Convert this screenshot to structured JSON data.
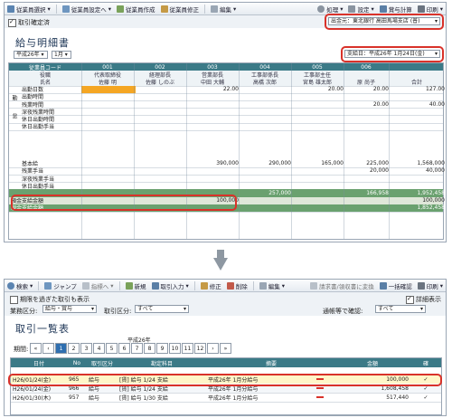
{
  "top": {
    "toolbar": {
      "select_label": "従業員選択",
      "settings_label": "従業員設定へ",
      "create_label": "従業員作成",
      "edit_label": "従業員修正",
      "edit_menu_label": "編集",
      "process_label": "処理",
      "config_label": "設定",
      "bonus_label": "賞与計算",
      "print_label": "印刷"
    },
    "confirmed_label": "取引確定済",
    "payer_label": "出金元：東北銀行 高田馬場支店 (普)",
    "title": "給与明細書",
    "year_select": "平成26年",
    "month_select": "1月",
    "payday_label": "支給日：平成26年 1月24日(金)",
    "grid": {
      "left_labels": [
        "従業員コード",
        "役職",
        "氏名"
      ],
      "codes": [
        "001",
        "002",
        "003",
        "004",
        "005",
        "006"
      ],
      "positions": [
        "代表取締役",
        "経理部長",
        "営業部長",
        "工事部係長",
        "工事部主任",
        ""
      ],
      "names": [
        "佐藤 明",
        "佐藤 しのぶ",
        "中田 大輔",
        "高橋 次郎",
        "宮島 雄太郎",
        "原 尚子"
      ],
      "total_header": "合計",
      "section_attendance": "勤怠",
      "attendance_rows": [
        {
          "label": "出勤日数",
          "values": [
            "",
            "",
            "22.00",
            "",
            "20.00",
            "20.00",
            "127.00"
          ]
        },
        {
          "label": "出勤時間",
          "values": [
            "",
            "",
            "",
            "",
            "",
            "",
            ""
          ]
        },
        {
          "label": "残業時間",
          "values": [
            "",
            "",
            "",
            "",
            "",
            "20.00",
            "40.00"
          ]
        },
        {
          "label": "深夜残業時間",
          "values": [
            "",
            "",
            "",
            "",
            "",
            "",
            ""
          ]
        },
        {
          "label": "休日出勤時間",
          "values": [
            "",
            "",
            "",
            "",
            "",
            "",
            ""
          ]
        },
        {
          "label": "休日出勤手当",
          "values": [
            "",
            "",
            "",
            "",
            "",
            "",
            ""
          ]
        }
      ],
      "pay_rows": [
        {
          "label": "基本給",
          "values": [
            "",
            "",
            "390,000",
            "290,000",
            "165,000",
            "225,000",
            "1,568,000"
          ]
        },
        {
          "label": "残業手当",
          "values": [
            "",
            "",
            "",
            "",
            "",
            "20,000",
            "40,000"
          ]
        },
        {
          "label": "深夜残業手当",
          "values": [
            "",
            "",
            "",
            "",
            "",
            "",
            ""
          ]
        },
        {
          "label": "休日出勤手当",
          "values": [
            "",
            "",
            "",
            "",
            "",
            "",
            ""
          ]
        }
      ],
      "green_row_values": [
        "",
        "",
        "",
        "257,000",
        "",
        "166,958",
        "1,952,458"
      ],
      "highlight_row": {
        "label": "預金支給金額",
        "values": [
          "",
          "",
          "100,000",
          "",
          "",
          "",
          "100,000"
        ]
      },
      "bottom_row": {
        "label": "現金支給金額",
        "values": [
          "",
          "",
          "",
          "",
          "",
          "",
          "1,852,458"
        ]
      }
    }
  },
  "bottom": {
    "toolbar": {
      "search_label": "検索",
      "jump_label": "ジャンプ",
      "ledger_label": "指標へ",
      "new_label": "新規",
      "import_label": "取引入力",
      "edit_label": "修正",
      "delete_label": "削除",
      "edit_menu_label": "編集",
      "request_label": "請求書/領収書に変換",
      "bulk_label": "一括確認",
      "print_label": "印刷"
    },
    "filter": {
      "show_past_label": "期限を過ぎた取引も表示",
      "detail_label": "詳細表示",
      "category_label": "業務区分:",
      "category_value": "給与・賞与",
      "txn_label": "取引区分:",
      "txn_value": "すべて",
      "account_label": "通帳等で確認:",
      "account_value": "すべて"
    },
    "title": "取引一覧表",
    "period_label": "期間:",
    "year_label": "平成26年",
    "months": [
      "1",
      "2",
      "3",
      "4",
      "5",
      "6",
      "7",
      "8",
      "9",
      "10",
      "11",
      "12"
    ],
    "columns": [
      "日付",
      "No",
      "取引区分",
      "勘定科目",
      "摘要",
      "金額",
      "確"
    ],
    "rows": [
      {
        "date": "H26/01/24(金)",
        "no": "965",
        "type": "給与",
        "account": "[賃] 給与 1/24 支給",
        "memo": "平成26年 1月分給与",
        "amount": "100,000"
      },
      {
        "date": "H26/01/24(金)",
        "no": "966",
        "type": "給与",
        "account": "[賃] 給与 1/24 支給",
        "memo": "平成26年 1月分給与",
        "amount": "1,608,458"
      },
      {
        "date": "H26/01/30(木)",
        "no": "957",
        "type": "給与",
        "account": "[賃] 給与 1/30 支給",
        "memo": "平成26年 1月分給与",
        "amount": "517,440"
      }
    ]
  }
}
